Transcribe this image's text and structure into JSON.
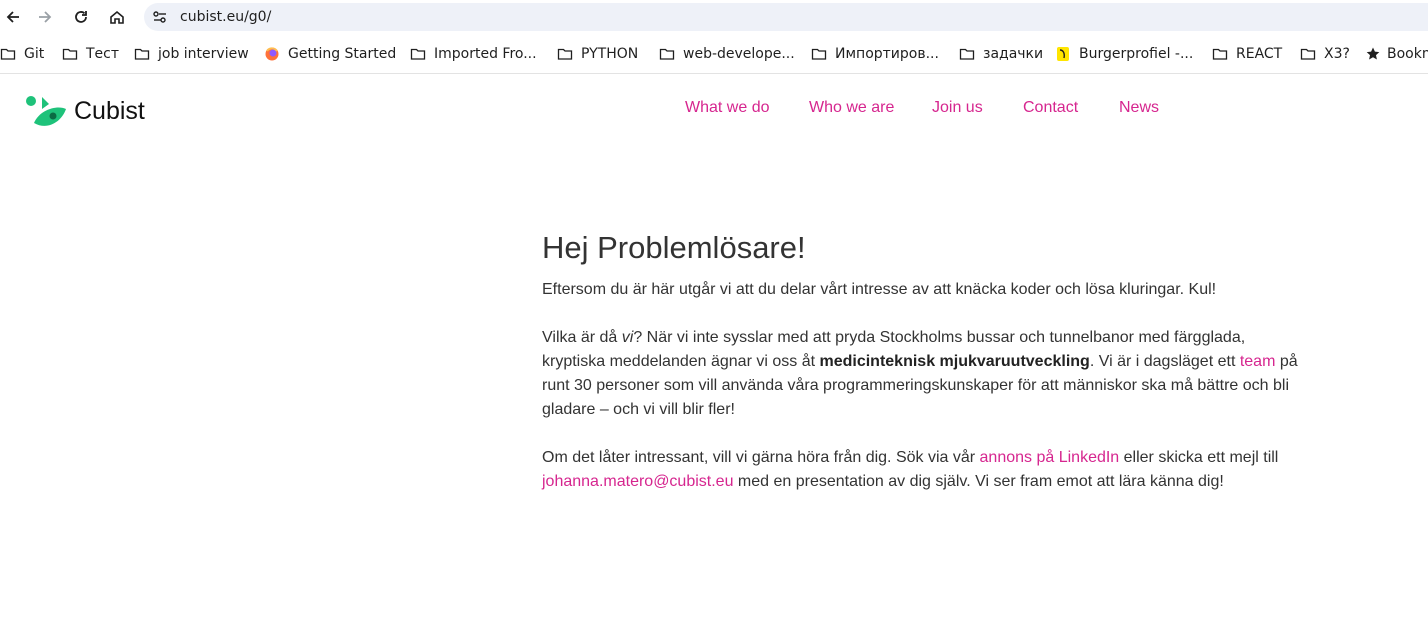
{
  "browser": {
    "url": "cubist.eu/g0/",
    "bookmarks": [
      {
        "label": "Git",
        "icon": "folder-icon"
      },
      {
        "label": "Тест",
        "icon": "folder-icon"
      },
      {
        "label": "job interview",
        "icon": "folder-icon"
      },
      {
        "label": "Getting Started",
        "icon": "firefox-icon"
      },
      {
        "label": "Imported Fro...",
        "icon": "folder-icon"
      },
      {
        "label": "PYTHON",
        "icon": "folder-icon"
      },
      {
        "label": "web-develope...",
        "icon": "folder-icon"
      },
      {
        "label": "Импортиров...",
        "icon": "folder-icon"
      },
      {
        "label": "задачки",
        "icon": "folder-icon"
      },
      {
        "label": "Burgerprofiel -...",
        "icon": "burger-lion-icon"
      },
      {
        "label": "REACT",
        "icon": "folder-icon"
      },
      {
        "label": "X3?",
        "icon": "folder-icon"
      },
      {
        "label": "Bookm",
        "icon": "star-icon"
      }
    ]
  },
  "site": {
    "logo_text": "Cubist",
    "brand_color": "#1ec27a",
    "link_color": "#d6268f",
    "nav": [
      "What we do",
      "Who we are",
      "Join us",
      "Contact",
      "News"
    ]
  },
  "content": {
    "heading": "Hej Problemlösare!",
    "p1": "Eftersom du är här utgår vi att du delar vårt intresse av att knäcka koder och lösa kluringar. Kul!",
    "p2": {
      "a": "Vilka är då ",
      "em": "vi",
      "b": "? När vi inte sysslar med att pryda Stockholms bussar och tunnelbanor med färgglada, kryptiska meddelanden ägnar vi oss åt ",
      "strong": "medicinteknisk mjukvaruutveckling",
      "c": ". Vi är i dagsläget ett ",
      "link": "team",
      "d": " på runt 30 personer som vill använda våra programmeringskunskaper för att människor ska må bättre och bli gladare – och vi vill blir fler!"
    },
    "p3": {
      "a": "Om det låter intressant, vill vi gärna höra från dig. Sök via vår ",
      "link1": "annons på LinkedIn",
      "b": " eller skicka ett mejl till ",
      "link2": "johanna.matero@cubist.eu",
      "c": " med en presentation av dig själv. Vi ser fram emot att lära känna dig!"
    }
  }
}
